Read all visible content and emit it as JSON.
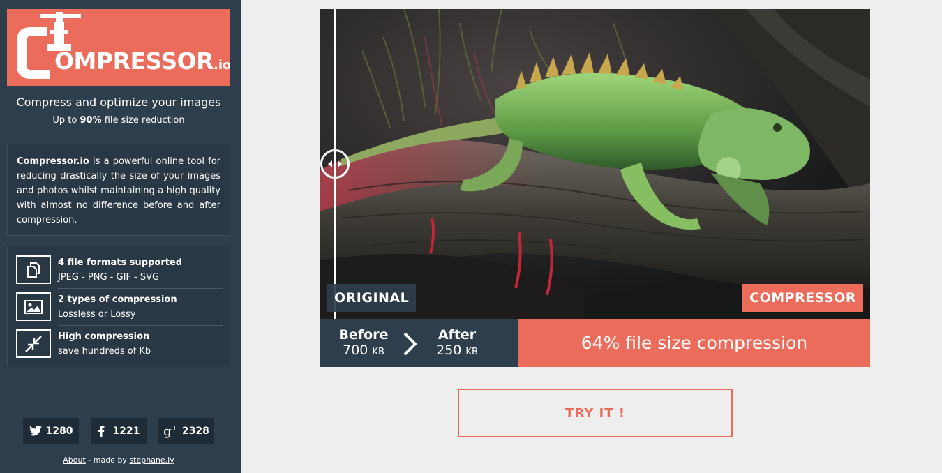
{
  "brand": {
    "name_main": "OMPRESSOR",
    "name_tld": ".io",
    "tagline": "Compress and optimize your images",
    "subtagline_prefix": "Up to ",
    "subtagline_bold": "90%",
    "subtagline_suffix": " file size reduction"
  },
  "description": {
    "bold": "Compressor.io",
    "text": " is a powerful online tool for reducing drastically the size of your images and photos whilst maintaining a high quality with almost no difference before and after compression."
  },
  "features": [
    {
      "icon": "files-icon",
      "title": "4 file formats supported",
      "subtitle": "JPEG - PNG - GIF - SVG"
    },
    {
      "icon": "image-icon",
      "title": "2 types of compression",
      "subtitle": "Lossless or Lossy"
    },
    {
      "icon": "compress-arrows-icon",
      "title": "High compression",
      "subtitle": "save hundreds of Kb"
    }
  ],
  "social": {
    "twitter_count": "1280",
    "facebook_count": "1221",
    "googleplus_count": "2328"
  },
  "footer": {
    "about": "About",
    "made_by": " - made by ",
    "author": "stephane.ly"
  },
  "showcase": {
    "label_original": "ORIGINAL",
    "label_compressor": "COMPRESSOR",
    "slider_position_percent": 2.7
  },
  "stats": {
    "before_label": "Before",
    "before_value": "700",
    "before_unit": "KB",
    "after_label": "After",
    "after_value": "250",
    "after_unit": "KB",
    "summary": "64% file size compression"
  },
  "cta": {
    "label": "TRY IT !"
  },
  "colors": {
    "accent": "#ec6c5b",
    "sidebar": "#2f3e4c",
    "background": "#eeeeee"
  }
}
